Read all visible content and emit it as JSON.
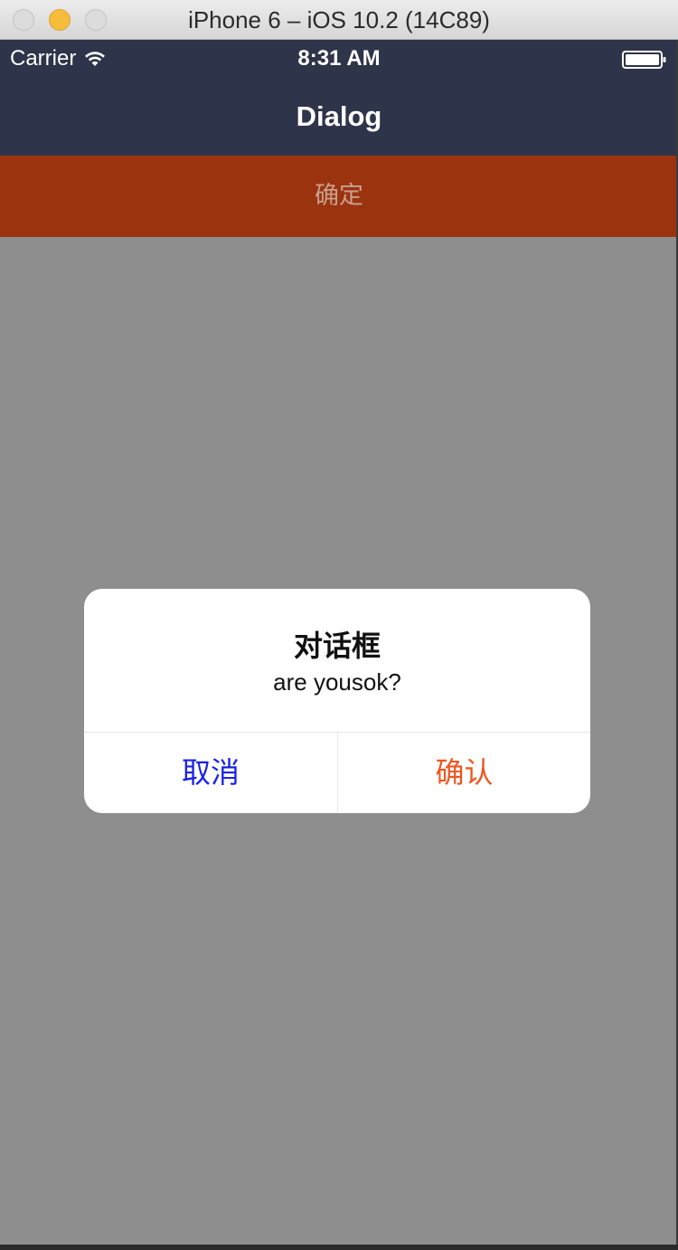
{
  "window": {
    "title": "iPhone 6 – iOS 10.2 (14C89)"
  },
  "status_bar": {
    "carrier": "Carrier",
    "time": "8:31 AM",
    "wifi_icon": "wifi-icon",
    "battery_icon": "battery-icon"
  },
  "nav": {
    "title": "Dialog"
  },
  "confirm_bar": {
    "label": "确定"
  },
  "dialog": {
    "title": "对话框",
    "message": "are yousok?",
    "cancel_label": "取消",
    "ok_label": "确认"
  },
  "colors": {
    "nav_bg": "#2e3449",
    "confirm_bar_bg": "#9b330f",
    "overlay": "#8e8e8e",
    "cancel_text": "#1a22e6",
    "ok_text": "#f0561f"
  }
}
